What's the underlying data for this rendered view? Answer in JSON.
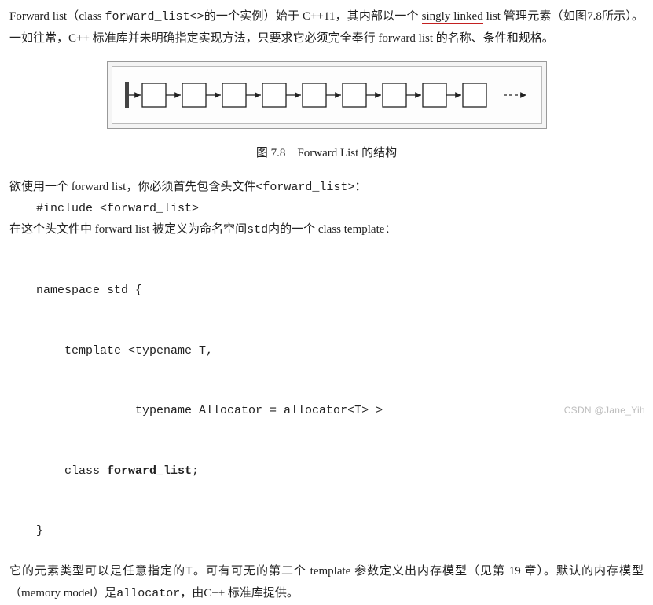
{
  "p1": {
    "s1a": "Forward list（class ",
    "s1b": "forward_list<>",
    "s1c": "的一个实例）始于 C++11，其内部以一个 ",
    "s1d": "singly linked",
    "s2": " list 管理元素（如图7.8所示）。一如往常，C++ 标准库并未明确指定实现方法，只要求它必须完全奉行 forward list 的名称、条件和规格。"
  },
  "caption": "图 7.8　Forward List 的结构",
  "p2": {
    "t1": "欲使用一个 forward list，你必须首先包含头文件",
    "t2": "<forward_list>",
    "t3": "："
  },
  "code1": "#include <forward_list>",
  "p3": {
    "t1": "在这个头文件中 forward list 被定义为命名空间",
    "t2": "std",
    "t3": "内的一个 class template："
  },
  "code2": {
    "l1": "namespace std {",
    "l2": "    template <typename T,",
    "l3": "              typename Allocator = allocator<T> >",
    "l4a": "    class ",
    "l4b": "forward_list",
    "l4c": ";",
    "l5": "}"
  },
  "p4": {
    "t1": "它的元素类型可以是任意指定的",
    "t2": "T",
    "t3": "。可有可无的第二个 template 参数定义出内存模型（见第 19 章）。默认的内存模型（memory model）是",
    "t4": "allocator",
    "t5": "，由C++ 标准库提供。"
  },
  "watermark": "CSDN @Jane_Yih",
  "chart_data": {
    "type": "diagram",
    "title": "Forward List 的结构",
    "description": "singly linked list",
    "start_bar": true,
    "nodes": 9,
    "trailing_arrow_style": "dashed",
    "layout": "horizontal"
  }
}
